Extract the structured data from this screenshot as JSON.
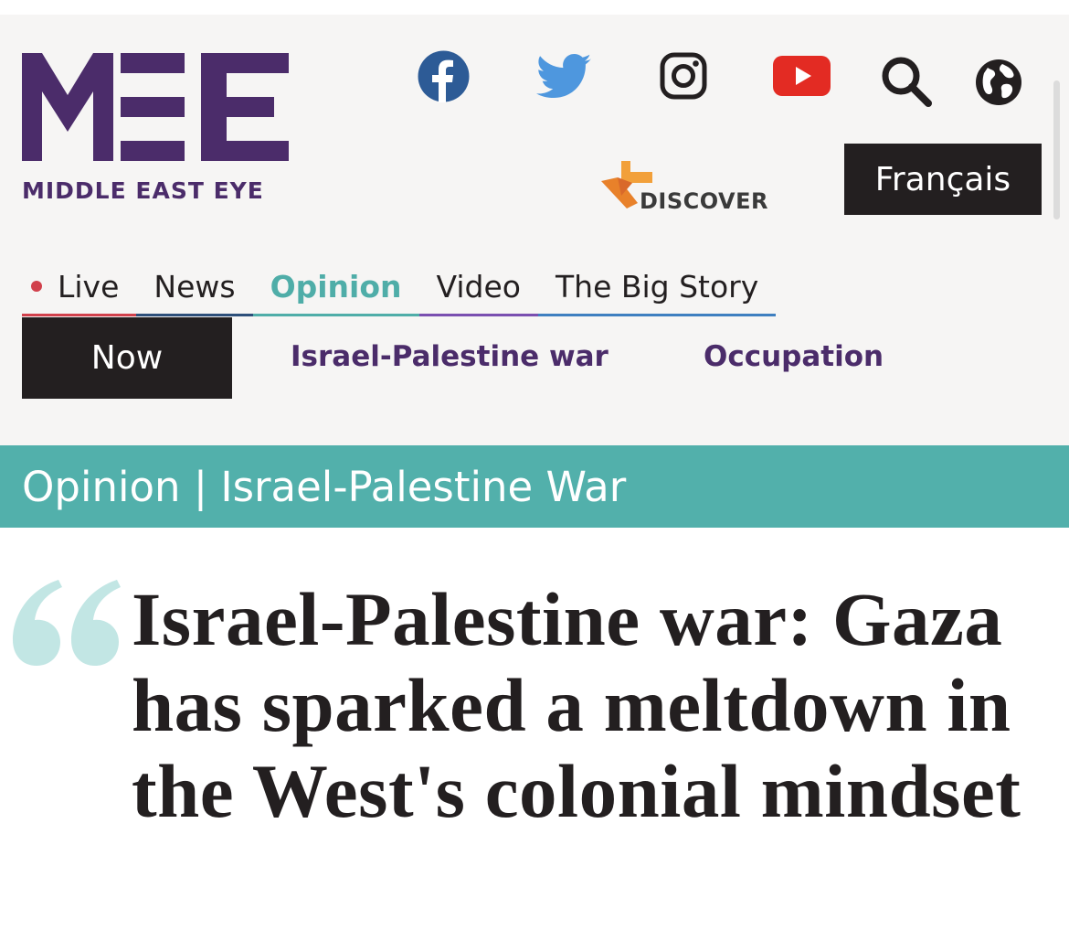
{
  "brand": {
    "name": "MIDDLE EAST EYE",
    "purple": "#4b2c6a"
  },
  "social": {
    "icons": [
      "facebook-icon",
      "twitter-icon",
      "instagram-icon",
      "youtube-icon",
      "search-icon",
      "globe-icon"
    ]
  },
  "discover": {
    "label": "DISCOVER"
  },
  "language": {
    "label": "Français"
  },
  "main_nav": {
    "items": [
      {
        "label": "Live",
        "color": "#d1404b"
      },
      {
        "label": "News",
        "color": "#2d4f7a"
      },
      {
        "label": "Opinion",
        "color": "#4fada8"
      },
      {
        "label": "Video",
        "color": "#7a4fb0"
      },
      {
        "label": "The Big Story",
        "color": "#3f7fc0"
      }
    ],
    "active": "Opinion"
  },
  "sub_nav": {
    "now": "Now",
    "links": [
      "Israel-Palestine war",
      "Occupation"
    ]
  },
  "section": {
    "label": "Opinion | Israel-Palestine War",
    "color": "#52b0ab"
  },
  "article": {
    "headline": "Israel-Palestine war: Gaza has sparked a meltdown in the West's colonial mindset"
  }
}
